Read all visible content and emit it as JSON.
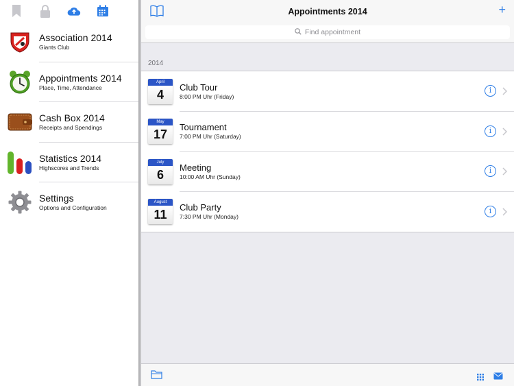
{
  "sidebar": {
    "toolbar": [
      {
        "icon": "bookmark-icon"
      },
      {
        "icon": "lock-icon"
      },
      {
        "icon": "cloud-upload-icon"
      },
      {
        "icon": "calendar-icon"
      }
    ],
    "items": [
      {
        "title": "Association 2014",
        "subtitle": "Giants Club",
        "icon": "club-badge-icon"
      },
      {
        "title": "Appointments 2014",
        "subtitle": "Place, Time, Attendance",
        "icon": "alarm-clock-icon"
      },
      {
        "title": "Cash Box 2014",
        "subtitle": "Receipts and Spendings",
        "icon": "wallet-icon"
      },
      {
        "title": "Statistics 2014",
        "subtitle": "Highscores and Trends",
        "icon": "bar-chart-icon"
      },
      {
        "title": "Settings",
        "subtitle": "Options and Configuration",
        "icon": "gear-icon"
      }
    ]
  },
  "main": {
    "title": "Appointments 2014",
    "add_label": "+",
    "search": {
      "placeholder": "Find appointment"
    },
    "section_header": "2014",
    "appointments": [
      {
        "month": "April",
        "day": "4",
        "title": "Club Tour",
        "time": "8:00 PM Uhr (Friday)"
      },
      {
        "month": "May",
        "day": "17",
        "title": "Tournament",
        "time": "7:00 PM Uhr (Saturday)"
      },
      {
        "month": "July",
        "day": "6",
        "title": "Meeting",
        "time": "10:00 AM Uhr (Sunday)"
      },
      {
        "month": "August",
        "day": "11",
        "title": "Club Party",
        "time": "7:30 PM Uhr (Monday)"
      }
    ],
    "info_glyph": "i"
  },
  "colors": {
    "accent": "#2e7ee6",
    "calendar_header": "#2b55c6",
    "sidebar_icon_inactive": "#c7c7cc"
  }
}
